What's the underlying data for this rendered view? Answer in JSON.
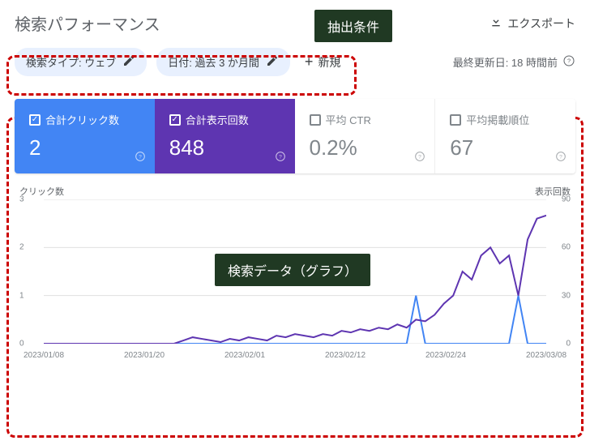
{
  "header": {
    "title": "検索パフォーマンス",
    "export_label": "エクスポート"
  },
  "annotations": {
    "filter_label": "抽出条件",
    "chart_label": "検索データ（グラフ）"
  },
  "filters": {
    "search_type": "検索タイプ: ウェブ",
    "date_range": "日付: 過去 3 か月間",
    "add_new": "新規",
    "last_updated": "最終更新日: 18 時間前"
  },
  "metrics": {
    "clicks": {
      "label": "合計クリック数",
      "value": "2"
    },
    "impressions": {
      "label": "合計表示回数",
      "value": "848"
    },
    "ctr": {
      "label": "平均 CTR",
      "value": "0.2%"
    },
    "position": {
      "label": "平均掲載順位",
      "value": "67"
    }
  },
  "chart_data": {
    "type": "line",
    "left_axis_title": "クリック数",
    "right_axis_title": "表示回数",
    "y_left": {
      "ticks": [
        0,
        1,
        2,
        3
      ],
      "range": [
        0,
        3
      ]
    },
    "y_right": {
      "ticks": [
        0,
        30,
        60,
        90
      ],
      "range": [
        0,
        90
      ]
    },
    "x_labels": [
      "2023/01/08",
      "2023/01/20",
      "2023/02/01",
      "2023/02/12",
      "2023/02/24",
      "2023/03/08"
    ],
    "series": [
      {
        "name": "clicks",
        "axis": "left",
        "color": "#4285f4",
        "values": [
          0,
          0,
          0,
          0,
          0,
          0,
          0,
          0,
          0,
          0,
          0,
          0,
          0,
          0,
          0,
          0,
          0,
          0,
          0,
          0,
          0,
          0,
          0,
          0,
          0,
          0,
          0,
          0,
          0,
          0,
          0,
          0,
          0,
          0,
          0,
          0,
          0,
          0,
          0,
          0,
          1,
          0,
          0,
          0,
          0,
          0,
          0,
          0,
          0,
          0,
          0,
          1,
          0,
          0,
          0
        ]
      },
      {
        "name": "impressions",
        "axis": "right",
        "color": "#5e35b1",
        "values": [
          0,
          0,
          0,
          0,
          0,
          0,
          0,
          0,
          0,
          0,
          0,
          0,
          0,
          0,
          0,
          2,
          4,
          3,
          2,
          1,
          3,
          2,
          4,
          3,
          2,
          5,
          4,
          6,
          5,
          4,
          6,
          5,
          8,
          7,
          9,
          8,
          10,
          9,
          12,
          10,
          15,
          14,
          18,
          25,
          30,
          45,
          40,
          55,
          60,
          50,
          55,
          30,
          65,
          78,
          80
        ]
      }
    ]
  }
}
